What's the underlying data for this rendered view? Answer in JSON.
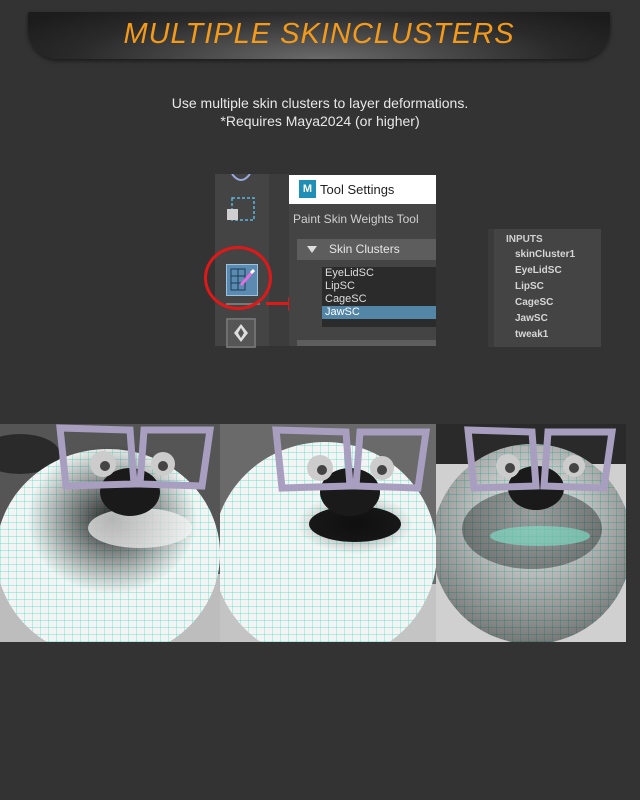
{
  "header": {
    "title": "MULTIPLE SKINCLUSTERS"
  },
  "description": {
    "line1": "Use multiple skin clusters to layer deformations.",
    "line2": "*Requires Maya2024 (or higher)"
  },
  "tool_settings": {
    "window_title": "Tool Settings",
    "logo_letter": "M",
    "tool_name": "Paint Skin Weights Tool",
    "section_label": "Skin Clusters",
    "clusters": [
      "EyeLidSC",
      "LipSC",
      "CageSC",
      "JawSC"
    ],
    "selected_cluster": "JawSC"
  },
  "inputs_panel": {
    "title": "INPUTS",
    "items": [
      "skinCluster1",
      "EyeLidSC",
      "LipSC",
      "CageSC",
      "JawSC",
      "tweak1"
    ]
  },
  "colors": {
    "accent_orange": "#f39a1b",
    "highlight_red": "#e01818",
    "selection_blue": "#5285a6",
    "wireframe_cyan": "#3fe0c0"
  },
  "icons": [
    "paint-skin-weights-icon",
    "move-tool-icon",
    "shelf-icon"
  ]
}
